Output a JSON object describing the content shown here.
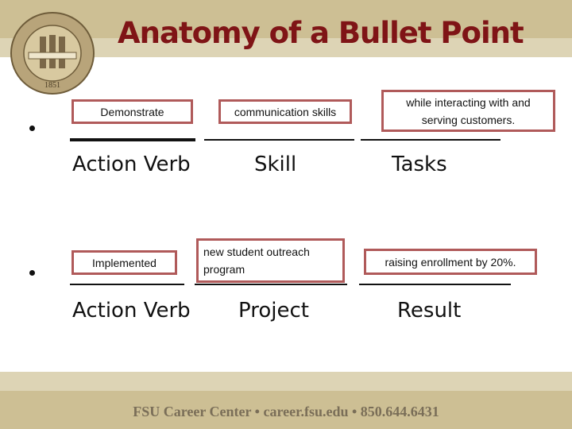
{
  "header": {
    "title": "Anatomy of a Bullet Point",
    "seal_text": "FLORIDA STATE UNIVERSITY 1851"
  },
  "bullets": [
    {
      "boxes": [
        "Demonstrate",
        "communication skills",
        "while interacting with and serving customers."
      ],
      "labels": [
        "Action Verb",
        "Skill",
        "Tasks"
      ]
    },
    {
      "boxes": [
        "Implemented",
        "new student outreach program",
        "raising enrollment by 20%."
      ],
      "labels": [
        "Action Verb",
        "Project",
        "Result"
      ]
    }
  ],
  "footer": {
    "text": "FSU Career Center • career.fsu.edu • 850.644.6431"
  },
  "colors": {
    "title": "#7f1416",
    "band_dark": "#cdbf94",
    "band_light": "#ddd4b5",
    "box_border": "#b05a5a"
  }
}
